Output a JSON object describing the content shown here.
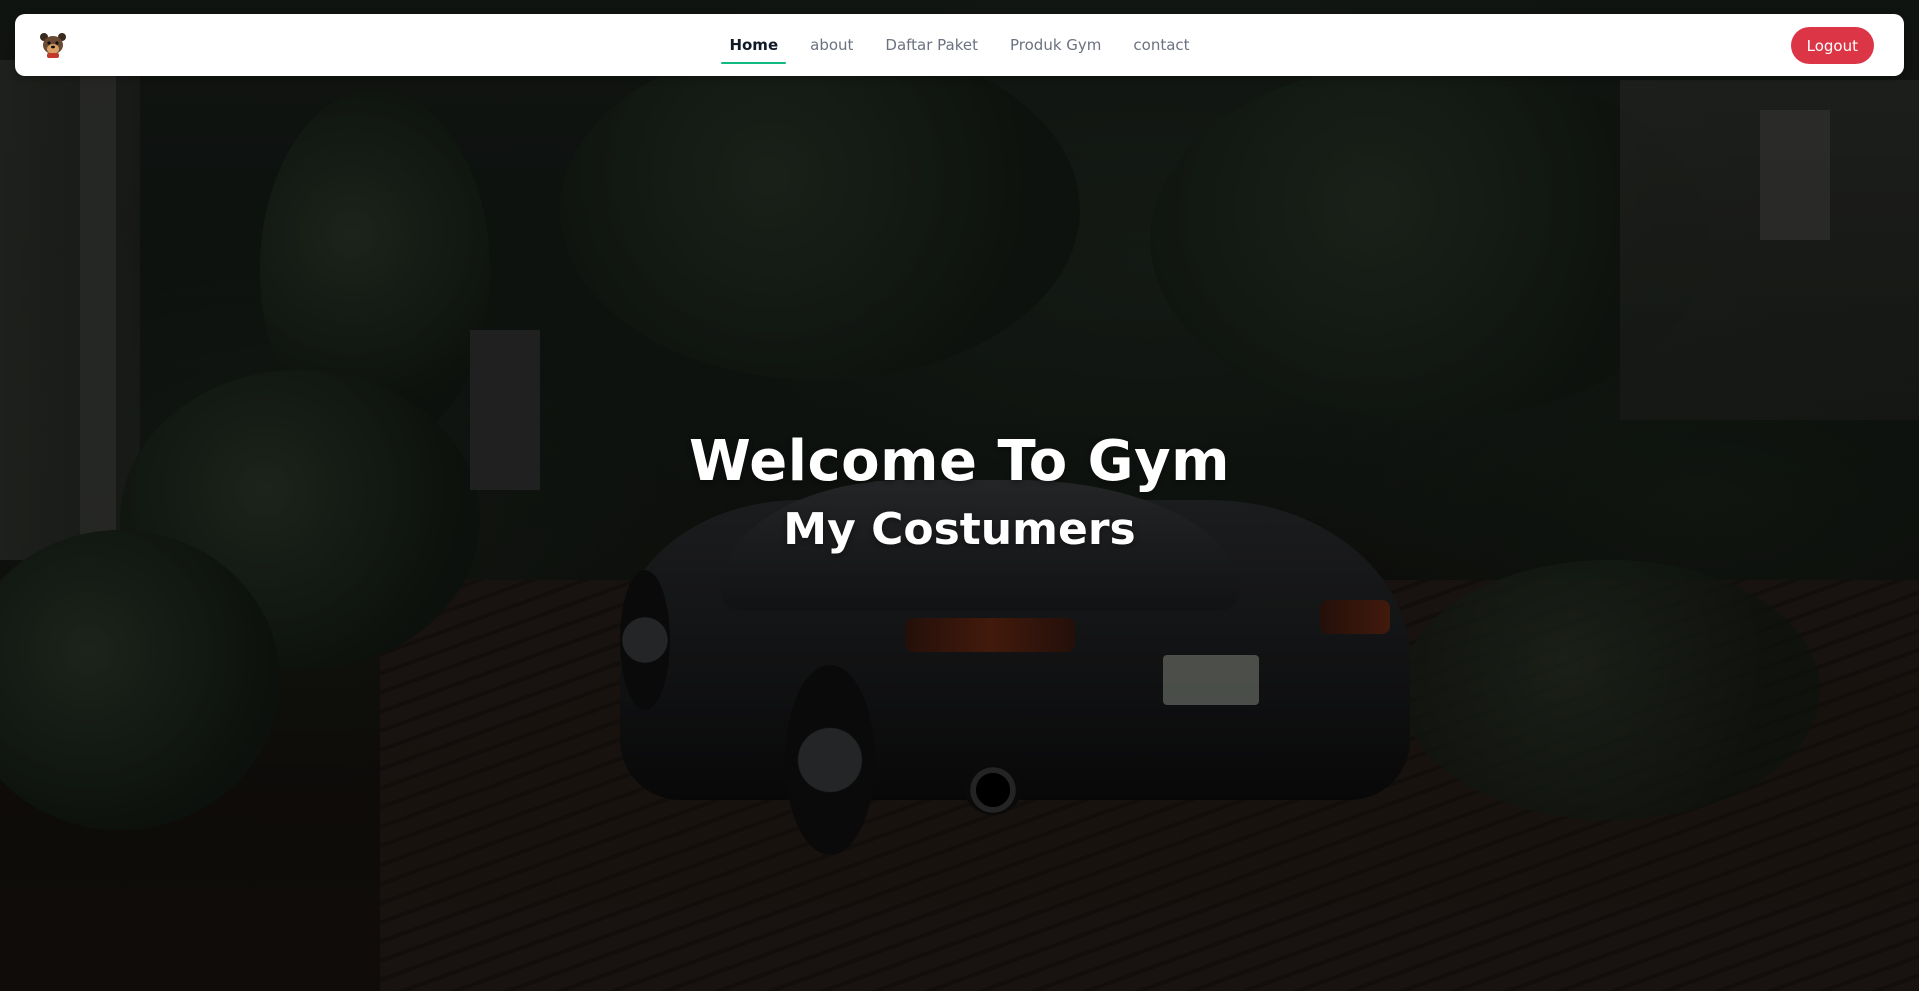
{
  "navbar": {
    "logo_icon": "bear-mascot-icon",
    "links": [
      {
        "label": "Home",
        "active": true
      },
      {
        "label": "about",
        "active": false
      },
      {
        "label": "Daftar Paket",
        "active": false
      },
      {
        "label": "Produk Gym",
        "active": false
      },
      {
        "label": "contact",
        "active": false
      }
    ],
    "logout_label": "Logout"
  },
  "hero": {
    "title": "Welcome To Gym",
    "subtitle": "My Costumers"
  },
  "colors": {
    "accent_underline": "#10b981",
    "logout_button": "#dc3545",
    "navbar_bg": "#ffffff"
  }
}
